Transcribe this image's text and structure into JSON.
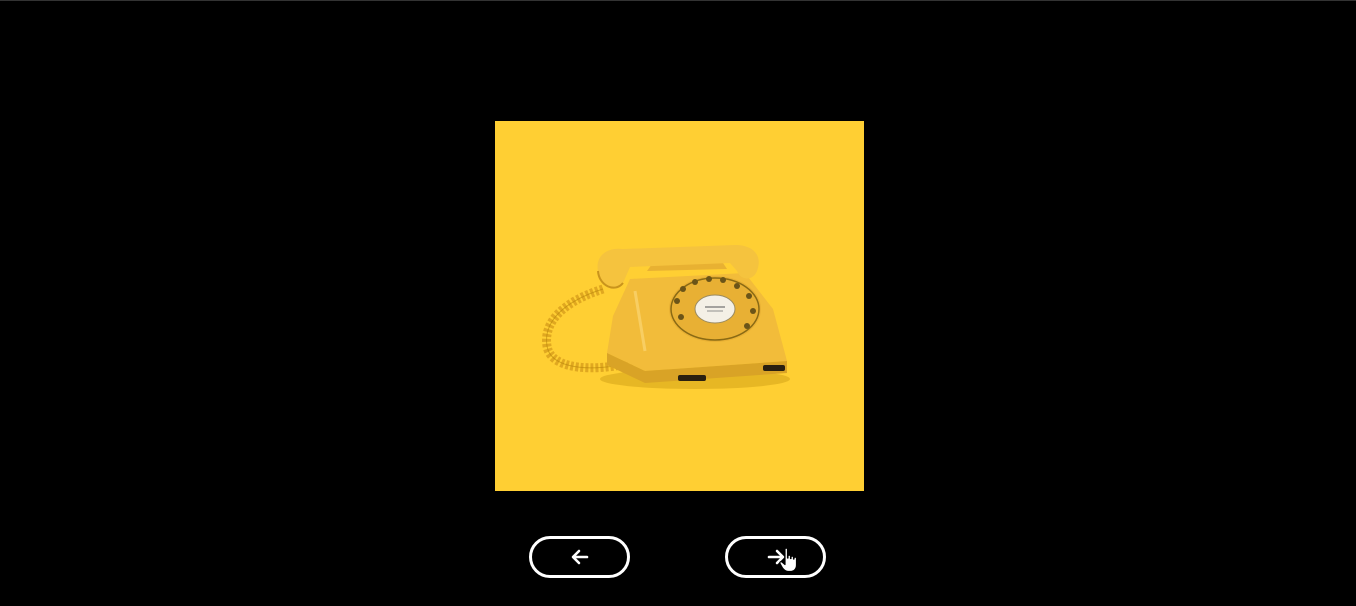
{
  "slider": {
    "current_image": "yellow-rotary-telephone",
    "background_color": "#ffcf33",
    "page_background": "#000000"
  },
  "controls": {
    "prev_icon": "arrow-left-icon",
    "next_icon": "arrow-right-icon",
    "button_border_color": "#ffffff"
  },
  "pointer": {
    "icon": "hand-pointer-icon"
  }
}
